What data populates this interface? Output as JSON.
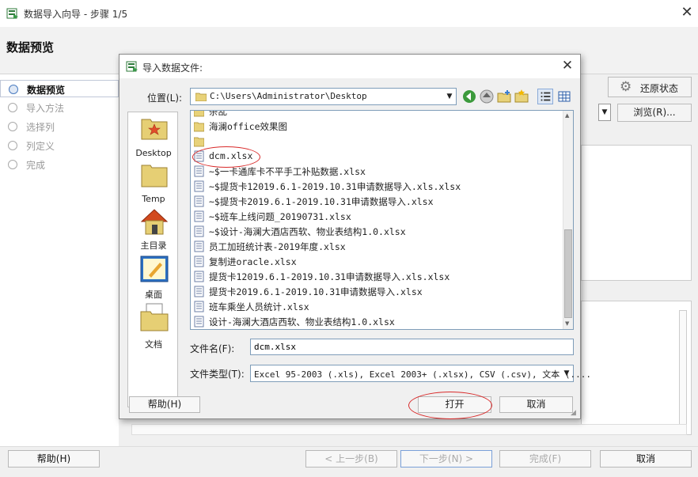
{
  "wizard": {
    "title": "数据导入向导 - 步骤 1/5",
    "page_title": "数据预览",
    "steps": [
      "数据预览",
      "导入方法",
      "选择列",
      "列定义",
      "完成"
    ],
    "restore_label": "还原状态",
    "browse_label": "浏览(R)...",
    "buttons": {
      "help": "帮助(H)",
      "prev": "< 上一步(B)",
      "next": "下一步(N) >",
      "finish": "完成(F)",
      "cancel": "取消"
    }
  },
  "dialog": {
    "title": "导入数据文件:",
    "location_label": "位置(L):",
    "location_path": "C:\\Users\\Administrator\\Desktop",
    "places": [
      "Desktop",
      "Temp",
      "主目录",
      "桌面",
      "文档"
    ],
    "files": [
      {
        "name": "杂乱",
        "type": "folder"
      },
      {
        "name": "海澜office效果图",
        "type": "folder"
      },
      {
        "name": "",
        "type": "folder"
      },
      {
        "name": "dcm.xlsx",
        "type": "file"
      },
      {
        "name": "~$一卡通库卡不平手工补贴数据.xlsx",
        "type": "file"
      },
      {
        "name": "~$提货卡12019.6.1-2019.10.31申请数据导入.xls.xlsx",
        "type": "file"
      },
      {
        "name": "~$提货卡2019.6.1-2019.10.31申请数据导入.xlsx",
        "type": "file"
      },
      {
        "name": "~$班车上线问题_20190731.xlsx",
        "type": "file"
      },
      {
        "name": "~$设计-海澜大酒店西软、物业表结构1.0.xlsx",
        "type": "file"
      },
      {
        "name": "员工加班统计表-2019年度.xlsx",
        "type": "file"
      },
      {
        "name": "复制进oracle.xlsx",
        "type": "file"
      },
      {
        "name": "提货卡12019.6.1-2019.10.31申请数据导入.xls.xlsx",
        "type": "file"
      },
      {
        "name": "提货卡2019.6.1-2019.10.31申请数据导入.xlsx",
        "type": "file"
      },
      {
        "name": "班车乘坐人员统计.xlsx",
        "type": "file"
      },
      {
        "name": "设计-海澜大酒店西软、物业表结构1.0.xlsx",
        "type": "file"
      }
    ],
    "filename_label": "文件名(F):",
    "filename_value": "dcm.xlsx",
    "filetype_label": "文件类型(T):",
    "filetype_value": "Excel 95-2003 (.xls), Excel 2003+ (.xlsx), CSV (.csv), 文本 (....",
    "buttons": {
      "help": "帮助(H)",
      "open": "打开",
      "cancel": "取消"
    }
  },
  "colors": {
    "annotation": "#d92a2a",
    "folder": "#e8d27a",
    "accent": "#4a7bc0"
  }
}
